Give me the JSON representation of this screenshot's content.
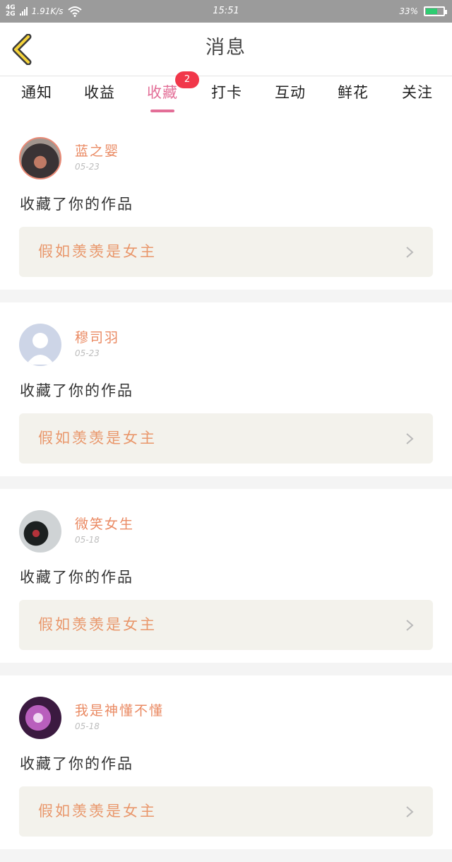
{
  "status_bar": {
    "network_top": "4G",
    "network_bottom": "2G",
    "speed": "1.91K/s",
    "time": "15:51",
    "battery": "33%"
  },
  "header": {
    "title": "消息",
    "back_icon": "chevron-left-icon"
  },
  "tabs": {
    "items": [
      {
        "label": "通知"
      },
      {
        "label": "收益"
      },
      {
        "label": "收藏"
      },
      {
        "label": "打卡"
      },
      {
        "label": "互动"
      },
      {
        "label": "鲜花"
      },
      {
        "label": "关注"
      }
    ],
    "active_index": 2,
    "badge": "2"
  },
  "colors": {
    "accent": "#e36e97",
    "badge": "#f1374a",
    "username": "#ea8a63",
    "work_title": "#e9976b"
  },
  "messages": [
    {
      "username": "蓝之婴",
      "date": "05-23",
      "action": "收藏了你的作品",
      "work_title": "假如羡羡是女主"
    },
    {
      "username": "穆司羽",
      "date": "05-23",
      "action": "收藏了你的作品",
      "work_title": "假如羡羡是女主"
    },
    {
      "username": "微笑女生",
      "date": "05-18",
      "action": "收藏了你的作品",
      "work_title": "假如羡羡是女主"
    },
    {
      "username": "我是神懂不懂",
      "date": "05-18",
      "action": "收藏了你的作品",
      "work_title": "假如羡羡是女主"
    }
  ]
}
